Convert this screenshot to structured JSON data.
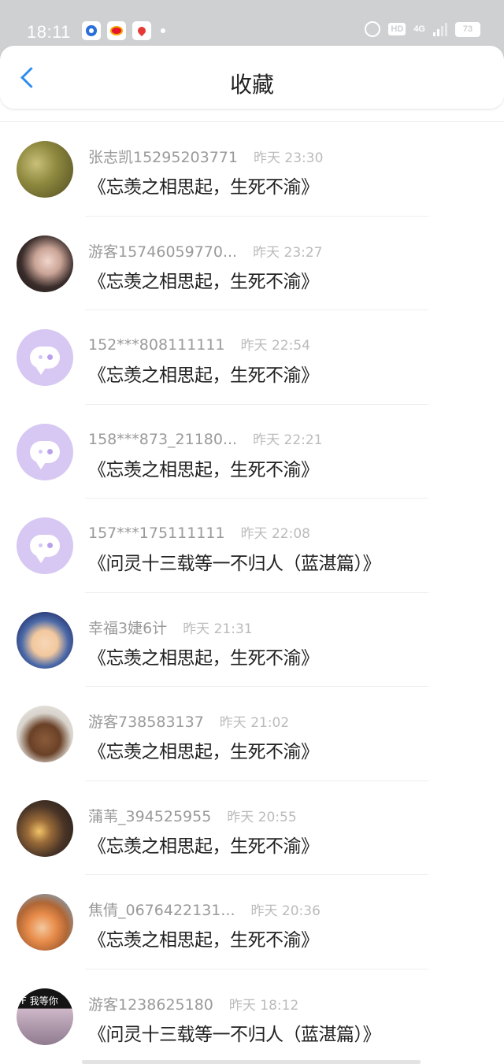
{
  "status_bar": {
    "time": "18:11",
    "hd": "HD",
    "network": "4G",
    "battery": "73"
  },
  "header": {
    "title": "收藏"
  },
  "items": [
    {
      "username": "张志凯15295203771",
      "time": "昨天 23:30",
      "title": "《忘羡之相思起，生死不渝》"
    },
    {
      "username": "游客15746059770...",
      "time": "昨天 23:27",
      "title": "《忘羡之相思起，生死不渝》"
    },
    {
      "username": "152***808111111",
      "time": "昨天 22:54",
      "title": "《忘羡之相思起，生死不渝》"
    },
    {
      "username": "158***873_21180...",
      "time": "昨天 22:21",
      "title": "《忘羡之相思起，生死不渝》"
    },
    {
      "username": "157***175111111",
      "time": "昨天 22:08",
      "title": "《问灵十三载等一不归人（蓝湛篇）》"
    },
    {
      "username": "幸福3婕6计",
      "time": "昨天 21:31",
      "title": "《忘羡之相思起，生死不渝》"
    },
    {
      "username": "游客738583137",
      "time": "昨天 21:02",
      "title": "《忘羡之相思起，生死不渝》"
    },
    {
      "username": "蒲苇_394525955",
      "time": "昨天 20:55",
      "title": "《忘羡之相思起，生死不渝》"
    },
    {
      "username": "焦倩_0676422131...",
      "time": "昨天 20:36",
      "title": "《忘羡之相思起，生死不渝》"
    },
    {
      "username": "游客1238625180",
      "time": "昨天 18:12",
      "title": "《问灵十三载等一不归人（蓝湛篇）》",
      "avatar_text": "F 我等你"
    }
  ]
}
